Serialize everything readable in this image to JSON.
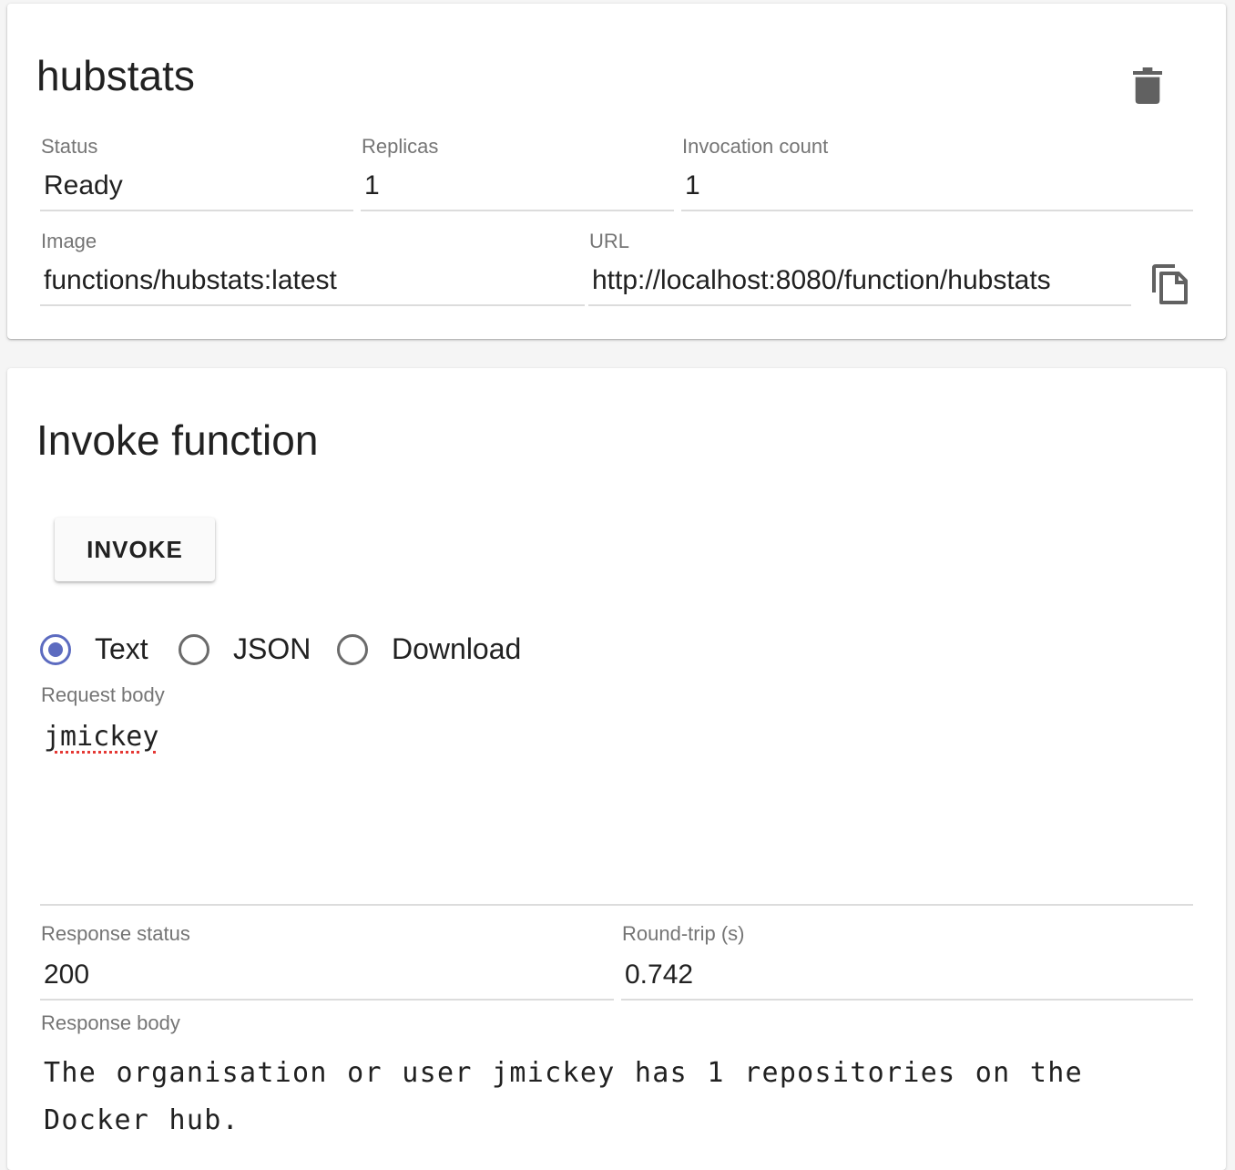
{
  "function_card": {
    "title": "hubstats",
    "status": {
      "label": "Status",
      "value": "Ready"
    },
    "replicas": {
      "label": "Replicas",
      "value": "1"
    },
    "invocation_count": {
      "label": "Invocation count",
      "value": "1"
    },
    "image": {
      "label": "Image",
      "value": "functions/hubstats:latest"
    },
    "url": {
      "label": "URL",
      "value": "http://localhost:8080/function/hubstats"
    },
    "delete_icon": "trash-icon",
    "copy_icon": "copy-icon"
  },
  "invoke_card": {
    "title": "Invoke function",
    "invoke_button": "INVOKE",
    "radio_options": [
      {
        "label": "Text",
        "checked": true
      },
      {
        "label": "JSON",
        "checked": false
      },
      {
        "label": "Download",
        "checked": false
      }
    ],
    "request_body": {
      "label": "Request body",
      "value": "jmickey"
    },
    "response_status": {
      "label": "Response status",
      "value": "200"
    },
    "round_trip": {
      "label": "Round-trip (s)",
      "value": "0.742"
    },
    "response_body": {
      "label": "Response body",
      "value": "The organisation or user jmickey has 1 repositories on the Docker hub."
    }
  },
  "colors": {
    "accent": "#5c6bc0",
    "icon": "#616161",
    "label": "#757575",
    "divider": "#dcdcdc"
  }
}
